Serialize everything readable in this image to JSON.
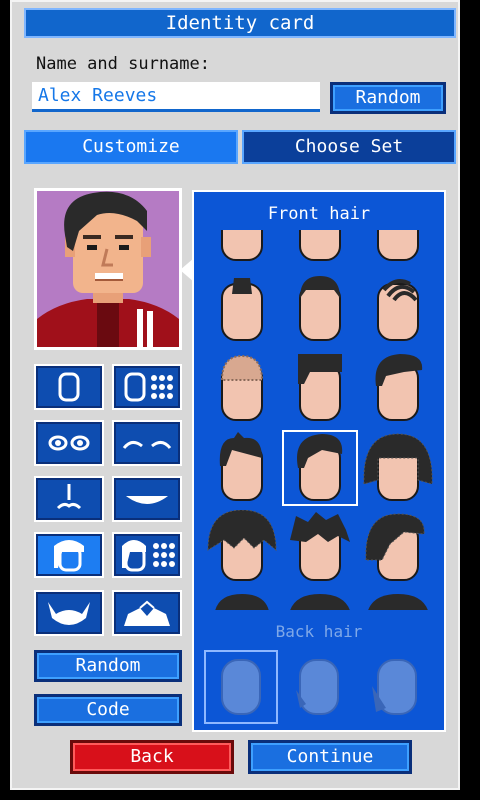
{
  "header": {
    "title": "Identity card"
  },
  "name_section": {
    "label": "Name and surname:",
    "value": "Alex Reeves",
    "random_label": "Random"
  },
  "tabs": [
    {
      "label": "Customize",
      "active": true
    },
    {
      "label": "Choose Set",
      "active": false
    }
  ],
  "part_buttons": [
    {
      "icon": "face-shape-icon"
    },
    {
      "icon": "face-color-icon"
    },
    {
      "icon": "eyes-icon"
    },
    {
      "icon": "eyebrows-icon"
    },
    {
      "icon": "nose-icon"
    },
    {
      "icon": "mouth-icon"
    },
    {
      "icon": "hair-icon",
      "selected": true
    },
    {
      "icon": "hair-color-icon"
    },
    {
      "icon": "beard-icon"
    },
    {
      "icon": "clothes-icon"
    }
  ],
  "left_actions": {
    "random_label": "Random",
    "code_label": "Code"
  },
  "panel": {
    "title": "Front hair",
    "back_hair_label": "Back hair"
  },
  "footer": {
    "back_label": "Back",
    "continue_label": "Continue"
  },
  "colors": {
    "accent": "#1a6fe0",
    "panel": "#0c56d6",
    "danger": "#d8101a"
  }
}
